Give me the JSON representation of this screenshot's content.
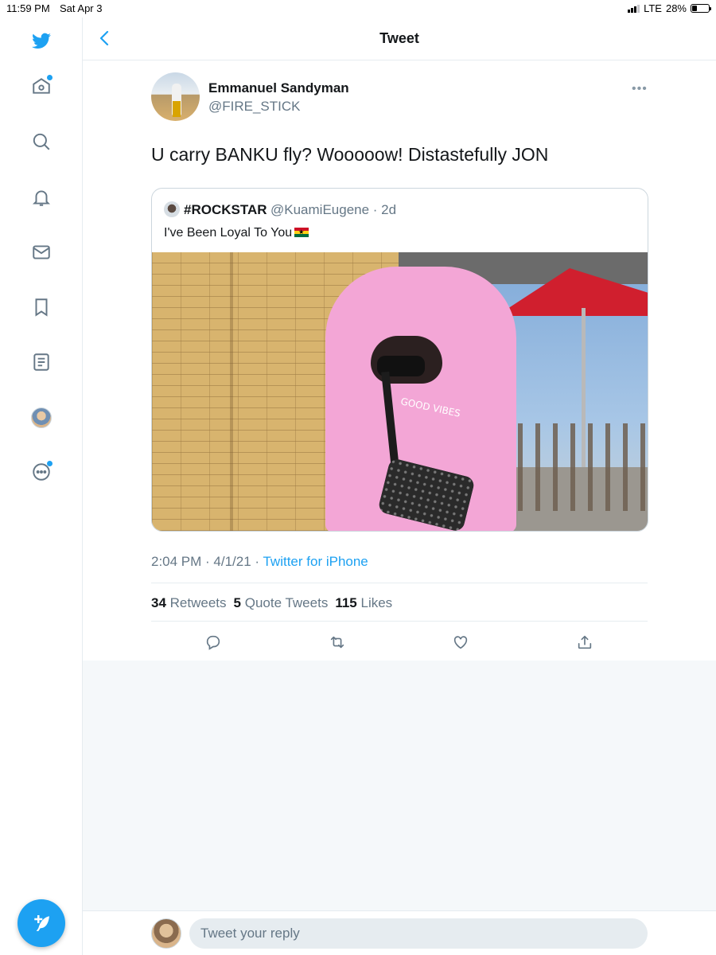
{
  "status_bar": {
    "time": "11:59 PM",
    "date": "Sat Apr 3",
    "network": "LTE",
    "battery": "28%",
    "battery_level": 0.28
  },
  "header": {
    "title": "Tweet"
  },
  "sidebar": {
    "items": [
      {
        "name": "home",
        "icon": "home-icon",
        "has_dot": true
      },
      {
        "name": "explore",
        "icon": "search-icon"
      },
      {
        "name": "notifications",
        "icon": "bell-icon"
      },
      {
        "name": "messages",
        "icon": "mail-icon"
      },
      {
        "name": "bookmarks",
        "icon": "bookmark-icon"
      },
      {
        "name": "lists",
        "icon": "list-icon"
      },
      {
        "name": "profile",
        "icon": "avatar"
      },
      {
        "name": "more",
        "icon": "more-circle-icon",
        "has_dot": true
      }
    ]
  },
  "tweet": {
    "author_name": "Emmanuel Sandyman",
    "author_handle": "@FIRE_STICK",
    "text": "U carry BANKU fly? Wooooow!  Distastefully JON",
    "quoted": {
      "name": "#ROCKSTAR",
      "handle_time": "@KuamiEugene · 2d",
      "text": "I've Been Loyal To You",
      "image_text": "GOOD VIBES"
    },
    "time_date": "2:04 PM · 4/1/21 · ",
    "source": "Twitter for iPhone",
    "stats": {
      "retweets_count": "34",
      "retweets_label": "Retweets",
      "quotes_count": "5",
      "quotes_label": "Quote Tweets",
      "likes_count": "115",
      "likes_label": "Likes"
    }
  },
  "reply": {
    "placeholder": "Tweet your reply"
  },
  "colors": {
    "accent": "#1da1f2",
    "text": "#14171a",
    "secondary": "#657786",
    "border": "#e6ecf0"
  }
}
